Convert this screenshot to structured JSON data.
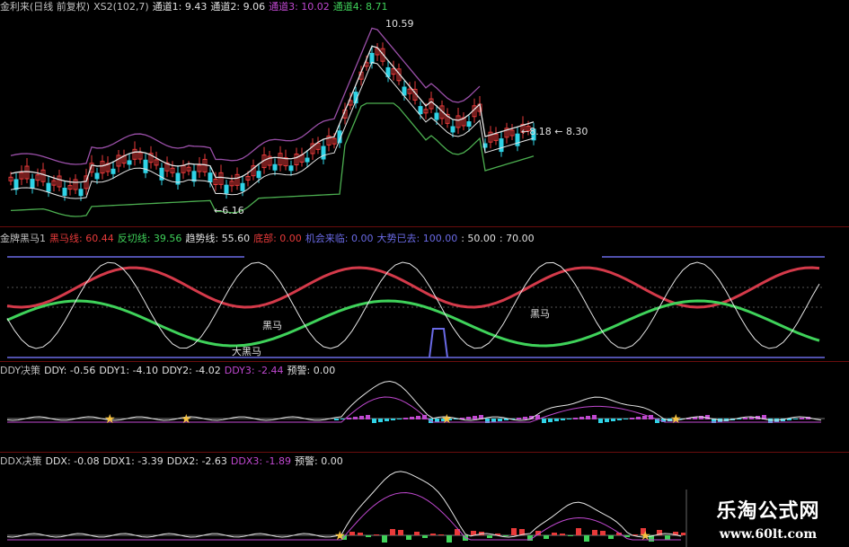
{
  "colors": {
    "background": "#000000",
    "separator": "#6a0d0d",
    "up_candle": "#e83a3a",
    "down_candle": "#2fd3e6",
    "price_line_white": "#e6e6e6",
    "channel_purple": "#9a4fa8",
    "channel_green": "#4caf50",
    "red_line": "#d43a4a",
    "green_line": "#3fd25a",
    "blue_line": "#6a6ae6",
    "star": "#f5c242",
    "magenta": "#c048d0"
  },
  "main_panel": {
    "legend": [
      {
        "text": "金利来(日线 前复权)",
        "color": "#c0c0c0"
      },
      {
        "text": "XS2(102,7)",
        "color": "#c0c0c0"
      },
      {
        "text": "通道1: 9.43",
        "color": "#e0e0e0"
      },
      {
        "text": "通道2: 9.06",
        "color": "#e0e0e0"
      },
      {
        "text": "通道3: 10.02",
        "color": "#c048d0"
      },
      {
        "text": "通道4: 8.71",
        "color": "#3fd25a"
      }
    ],
    "annotations": {
      "high_label": "10.59",
      "low_label": "6.16",
      "last_label_a": "8.18",
      "last_label_b": "8.30"
    }
  },
  "panel_heima": {
    "legend": [
      {
        "text": "金牌黑马1",
        "color": "#c0c0c0"
      },
      {
        "text": "黑马线: 60.44",
        "color": "#e83a3a"
      },
      {
        "text": "反切线: 39.56",
        "color": "#3fd25a"
      },
      {
        "text": "趋势线: 55.60",
        "color": "#e0e0e0"
      },
      {
        "text": "底部: 0.00",
        "color": "#e83a3a"
      },
      {
        "text": "机会来临: 0.00",
        "color": "#6a6ae6"
      },
      {
        "text": "大势已去: 100.00",
        "color": "#6a6ae6"
      },
      {
        "text": ": 50.00",
        "color": "#e0e0e0"
      },
      {
        "text": ": 70.00",
        "color": "#e0e0e0"
      }
    ],
    "labels": {
      "heima_a": "黑马",
      "heima_b": "黑马",
      "da_heima": "大黑马"
    }
  },
  "panel_ddy": {
    "legend": [
      {
        "text": "DDY决策",
        "color": "#c0c0c0"
      },
      {
        "text": "DDY: -0.56",
        "color": "#e0e0e0"
      },
      {
        "text": "DDY1: -4.10",
        "color": "#e0e0e0"
      },
      {
        "text": "DDY2: -4.02",
        "color": "#e0e0e0"
      },
      {
        "text": "DDY3: -2.44",
        "color": "#c048d0"
      },
      {
        "text": "预警: 0.00",
        "color": "#e0e0e0"
      }
    ]
  },
  "panel_ddx": {
    "legend": [
      {
        "text": "DDX决策",
        "color": "#c0c0c0"
      },
      {
        "text": "DDX: -0.08",
        "color": "#e0e0e0"
      },
      {
        "text": "DDX1: -3.39",
        "color": "#e0e0e0"
      },
      {
        "text": "DDX2: -2.63",
        "color": "#e0e0e0"
      },
      {
        "text": "DDX3: -1.89",
        "color": "#c048d0"
      },
      {
        "text": "预警: 0.00",
        "color": "#e0e0e0"
      }
    ]
  },
  "watermark": {
    "title": "乐淘公式网",
    "url": "www.60lt.com"
  }
}
